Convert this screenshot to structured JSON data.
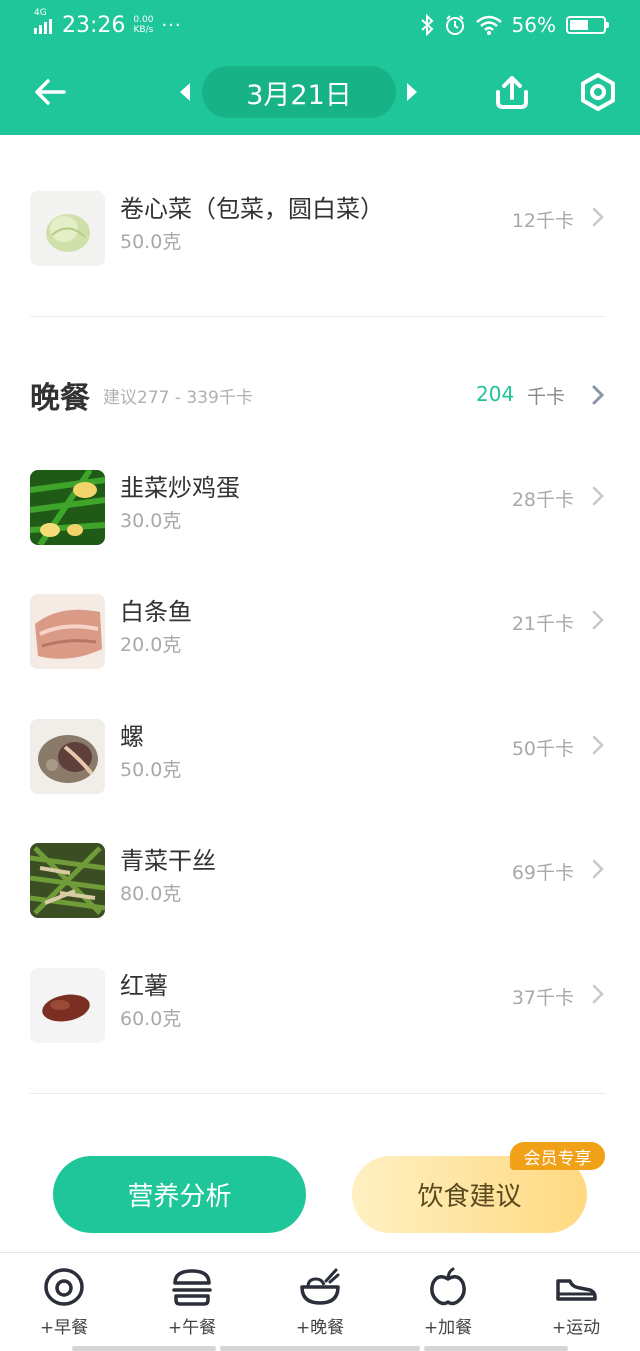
{
  "status_bar": {
    "network": "4G",
    "time": "23:26",
    "speed_value": "0.00",
    "speed_unit": "KB/s",
    "more": "···",
    "battery_percent": "56%",
    "battery_level": 0.56
  },
  "nav": {
    "date": "3月21日"
  },
  "colors": {
    "brand": "#1fc69a",
    "vip": "#f0a117"
  },
  "prev_item": {
    "name": "卷心菜（包菜，圆白菜）",
    "amount": "50.0克",
    "kcal": "12千卡",
    "thumb": "cabbage"
  },
  "dinner": {
    "title": "晚餐",
    "suggest": "建议277 - 339千卡",
    "total": "204",
    "unit": "千卡",
    "items": [
      {
        "name": "韭菜炒鸡蛋",
        "amount": "30.0克",
        "kcal": "28千卡",
        "thumb": "chive-egg"
      },
      {
        "name": "白条鱼",
        "amount": "20.0克",
        "kcal": "21千卡",
        "thumb": "fish"
      },
      {
        "name": "螺",
        "amount": "50.0克",
        "kcal": "50千卡",
        "thumb": "snail"
      },
      {
        "name": "青菜干丝",
        "amount": "80.0克",
        "kcal": "69千卡",
        "thumb": "greens-tofu"
      },
      {
        "name": "红薯",
        "amount": "60.0克",
        "kcal": "37千卡",
        "thumb": "sweet-potato"
      }
    ]
  },
  "actions": {
    "analysis": "营养分析",
    "advice": "饮食建议",
    "vip_badge": "会员专享"
  },
  "tabs": [
    {
      "label": "+早餐",
      "icon": "egg-icon"
    },
    {
      "label": "+午餐",
      "icon": "burger-icon"
    },
    {
      "label": "+晚餐",
      "icon": "bowl-icon"
    },
    {
      "label": "+加餐",
      "icon": "apple-icon"
    },
    {
      "label": "+运动",
      "icon": "shoe-icon"
    }
  ]
}
